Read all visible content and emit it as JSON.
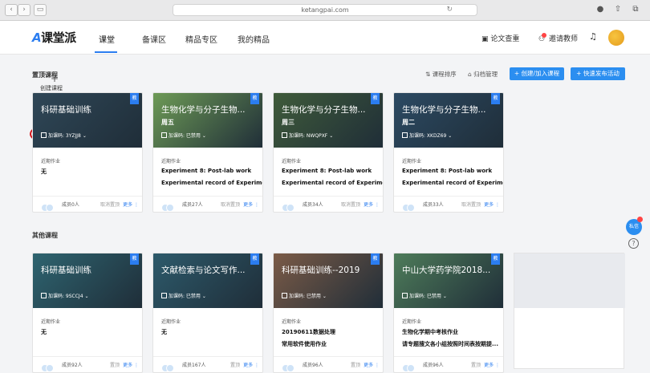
{
  "browser": {
    "url": "ketangpai.com"
  },
  "nav": {
    "logo": "课堂派",
    "items": [
      "课堂",
      "备课区",
      "精品专区",
      "我的精品"
    ],
    "right": {
      "paper_check": "论文查重",
      "invite": "邀请教师"
    }
  },
  "pinned": {
    "title": "置顶课程",
    "sort": "课程排序",
    "archive": "归档管理",
    "create_btn": "+ 创建/加入课程",
    "quick_btn": "+ 快速发布活动"
  },
  "other": {
    "title": "其他课程"
  },
  "cards_top": [
    {
      "title": "科研基础训练",
      "sub": "",
      "code": "加课码: 3YZJJ8",
      "badge": "教",
      "hw_label": "近期作业",
      "hw1": "无",
      "hw2": "",
      "members": "成员0人",
      "foot": "取消置顶",
      "more": "更多",
      "bg": "#2f4757"
    },
    {
      "title": "生物化学与分子生物...",
      "sub": "周五",
      "code": "加课码: 已禁用",
      "badge": "教",
      "hw_label": "近期作业",
      "hw1": "Experiment 8: Post-lab work",
      "hw2": "Experimental record of Experime...",
      "members": "成员27人",
      "foot": "取消置顶",
      "more": "更多",
      "bg": "#6d9a56"
    },
    {
      "title": "生物化学与分子生物...",
      "sub": "周三",
      "code": "加课码: NWQPXF",
      "badge": "教",
      "hw_label": "近期作业",
      "hw1": "Experiment 8: Post-lab work",
      "hw2": "Experimental record of Experime...",
      "members": "成员34人",
      "foot": "取消置顶",
      "more": "更多",
      "bg": "#3f5b3a"
    },
    {
      "title": "生物化学与分子生物...",
      "sub": "周二",
      "code": "加课码: XKDZ69",
      "badge": "教",
      "hw_label": "近期作业",
      "hw1": "Experiment 8: Post-lab work",
      "hw2": "Experimental record of Experime...",
      "members": "成员33人",
      "foot": "取消置顶",
      "more": "更多",
      "bg": "#2c4a63"
    }
  ],
  "cards_bottom": [
    {
      "title": "科研基础训练",
      "sub": "",
      "code": "加课码: 9SCCJ4",
      "badge": "教",
      "hw_label": "近期作业",
      "hw1": "无",
      "hw2": "",
      "members": "成员92人",
      "foot": "置顶",
      "more": "更多",
      "bg": "#2e6470"
    },
    {
      "title": "文献检索与论文写作...",
      "sub": "",
      "code": "加课码: 已禁用",
      "badge": "教",
      "hw_label": "近期作业",
      "hw1": "无",
      "hw2": "",
      "members": "成员167人",
      "foot": "置顶",
      "more": "更多",
      "bg": "#2d5a6b"
    },
    {
      "title": "科研基础训练--2019",
      "sub": "",
      "code": "加课码: 已禁用",
      "badge": "教",
      "hw_label": "近期作业",
      "hw1": "20190611数据处理",
      "hw2": "常用软件使用作业",
      "members": "成员96人",
      "foot": "置顶",
      "more": "更多",
      "bg": "#7b5b47"
    },
    {
      "title": "中山大学药学院2018...",
      "sub": "",
      "code": "加课码: 已禁用",
      "badge": "教",
      "hw_label": "近期作业",
      "hw1": "生物化学期中考核作业",
      "hw2": "请专题搜文各小组按照时间表按期提...",
      "members": "成员96人",
      "foot": "置顶",
      "more": "更多",
      "bg": "#4e7c5a"
    }
  ],
  "create_card": {
    "plus": "+",
    "label": "创建课程"
  },
  "fab": {
    "label": "私信"
  },
  "help": "?"
}
